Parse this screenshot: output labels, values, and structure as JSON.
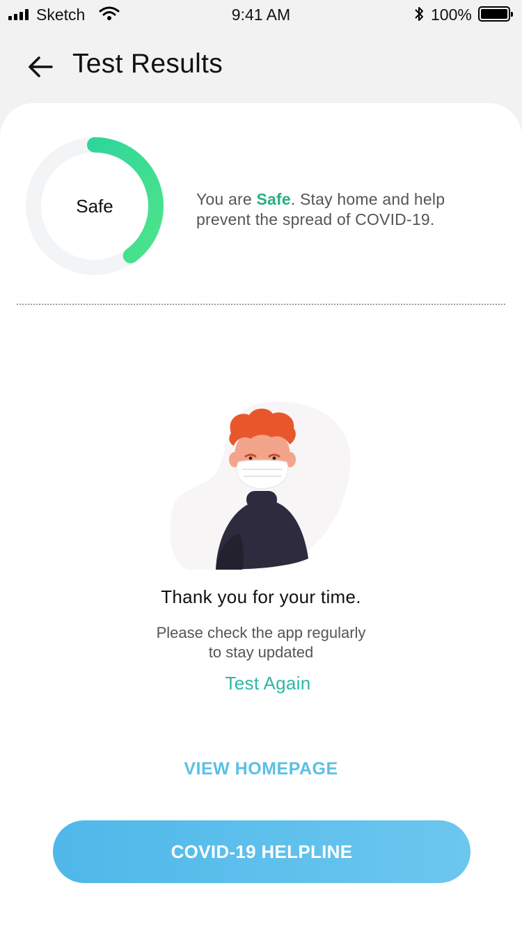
{
  "status_bar": {
    "carrier": "Sketch",
    "time": "9:41 AM",
    "battery": "100%",
    "icons": [
      "signal-icon",
      "wifi-icon",
      "bluetooth-icon",
      "battery-icon"
    ]
  },
  "header": {
    "back_icon": "arrow-left-icon",
    "title": "Test Results"
  },
  "result": {
    "status": "Safe",
    "progress_fraction": 0.4,
    "message_prefix": "You are ",
    "message_status": "Safe",
    "message_suffix": ". Stay home and help prevent the spread of COVID-19."
  },
  "body": {
    "illustration": "masked-person-illustration",
    "thanks": "Thank you for your time.",
    "sub_line1": "Please check the app regularly",
    "sub_line2": "to stay updated",
    "test_again": "Test Again"
  },
  "actions": {
    "view_homepage": "VIEW HOMEPAGE",
    "helpline": "COVID-19 HELPLINE"
  },
  "colors": {
    "background": "#f2f2f2",
    "safe_green": "#27b07f",
    "ring_start": "#2fd69a",
    "ring_end": "#4de38c",
    "teal_link": "#2db7a5",
    "blue_link": "#5bbfe6",
    "button_gradient_start": "#4fb8e9",
    "button_gradient_end": "#6cc7ef"
  }
}
